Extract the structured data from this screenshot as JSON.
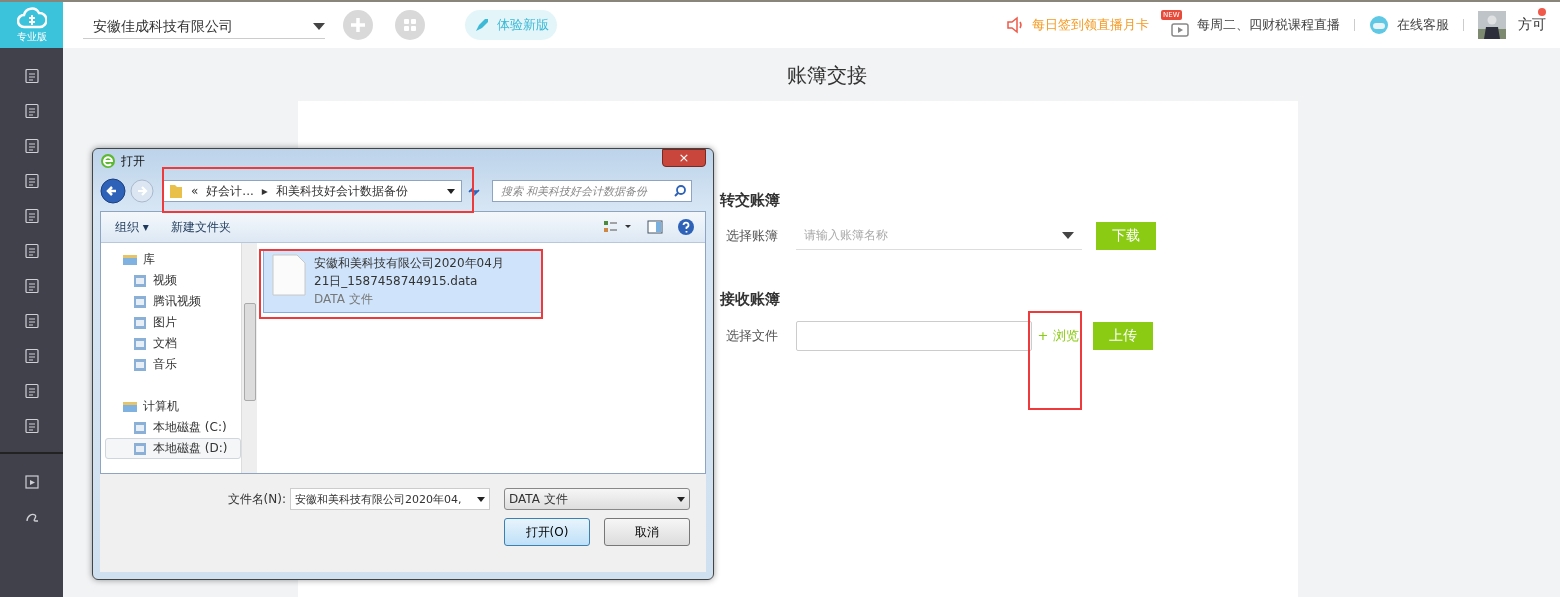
{
  "logo": {
    "label": "专业版"
  },
  "topbar": {
    "company": "安徽佳成科技有限公司",
    "new_version": "体验新版",
    "promo": "每日签到领直播月卡",
    "badge": "NEW",
    "live": "每周二、四财税课程直播",
    "service": "在线客服",
    "user": "方可",
    "notification": true
  },
  "page": {
    "title": "账簿交接",
    "transfer": {
      "heading": "转交账簿",
      "label": "选择账簿",
      "placeholder": "请输入账簿名称",
      "button": "下载"
    },
    "receive": {
      "heading": "接收账簿",
      "label": "选择文件",
      "browse": "+ 浏览",
      "button": "上传"
    }
  },
  "dialog": {
    "title": "打开",
    "close": "×",
    "breadcrumb": [
      "«",
      "好会计...",
      "▸",
      "和美科技好会计数据备份"
    ],
    "search_placeholder": "搜索 和美科技好会计数据备份",
    "toolbar": {
      "organize": "组织 ▾",
      "new_folder": "新建文件夹"
    },
    "tree": [
      {
        "label": "库",
        "selected": false,
        "children": [
          {
            "label": "视频",
            "selected": false
          },
          {
            "label": "腾讯视频",
            "selected": false
          },
          {
            "label": "图片",
            "selected": false
          },
          {
            "label": "文档",
            "selected": false
          },
          {
            "label": "音乐",
            "selected": false
          }
        ]
      },
      {
        "label": "计算机",
        "selected": false,
        "children": [
          {
            "label": "本地磁盘 (C:)",
            "selected": false
          },
          {
            "label": "本地磁盘 (D:)",
            "selected": true
          }
        ]
      }
    ],
    "files": [
      {
        "name": "安徽和美科技有限公司2020年04月21日_1587458744915.data",
        "type": "DATA 文件",
        "selected": true
      }
    ],
    "filename_label": "文件名(N):",
    "filename": "安徽和美科技有限公司2020年04,",
    "filetype": "DATA 文件",
    "open": "打开(O)",
    "cancel": "取消"
  }
}
